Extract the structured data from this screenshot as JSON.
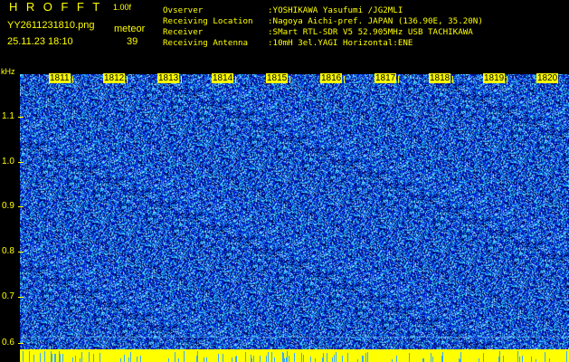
{
  "header": {
    "app_title": "HROFFT",
    "app_version": "1.00f",
    "filename": "YY2611231810.png",
    "datetime": "25.11.23 18:10",
    "meteor_label": "meteor",
    "meteor_count": "39"
  },
  "info": [
    {
      "label": "Ovserver",
      "value": ":YOSHIKAWA Yasufumi /JG2MLI"
    },
    {
      "label": "Receiving Location",
      "value": ":Nagoya Aichi-pref. JAPAN (136.90E, 35.20N)"
    },
    {
      "label": "Receiver",
      "value": ":SMart RTL-SDR V5 52.905MHz USB TACHIKAWA"
    },
    {
      "label": "Receiving Antenna",
      "value": ":10mH 3el.YAGI Horizontal:ENE"
    }
  ],
  "axis": {
    "y_unit": "kHz",
    "y_ticks": [
      "1.1",
      "1.0",
      "0.9",
      "0.8",
      "0.7",
      "0.6"
    ],
    "x_ticks": [
      "1811",
      "1812",
      "1813",
      "1814",
      "1815",
      "1816",
      "1817",
      "1818",
      "1819",
      "1820"
    ]
  },
  "colors": {
    "text": "#ffff00",
    "background": "#000000",
    "noise_dark": "#000040",
    "noise_blue": "#0020e0",
    "noise_cyan": "#30c8ff",
    "ground": "#ffff00"
  }
}
